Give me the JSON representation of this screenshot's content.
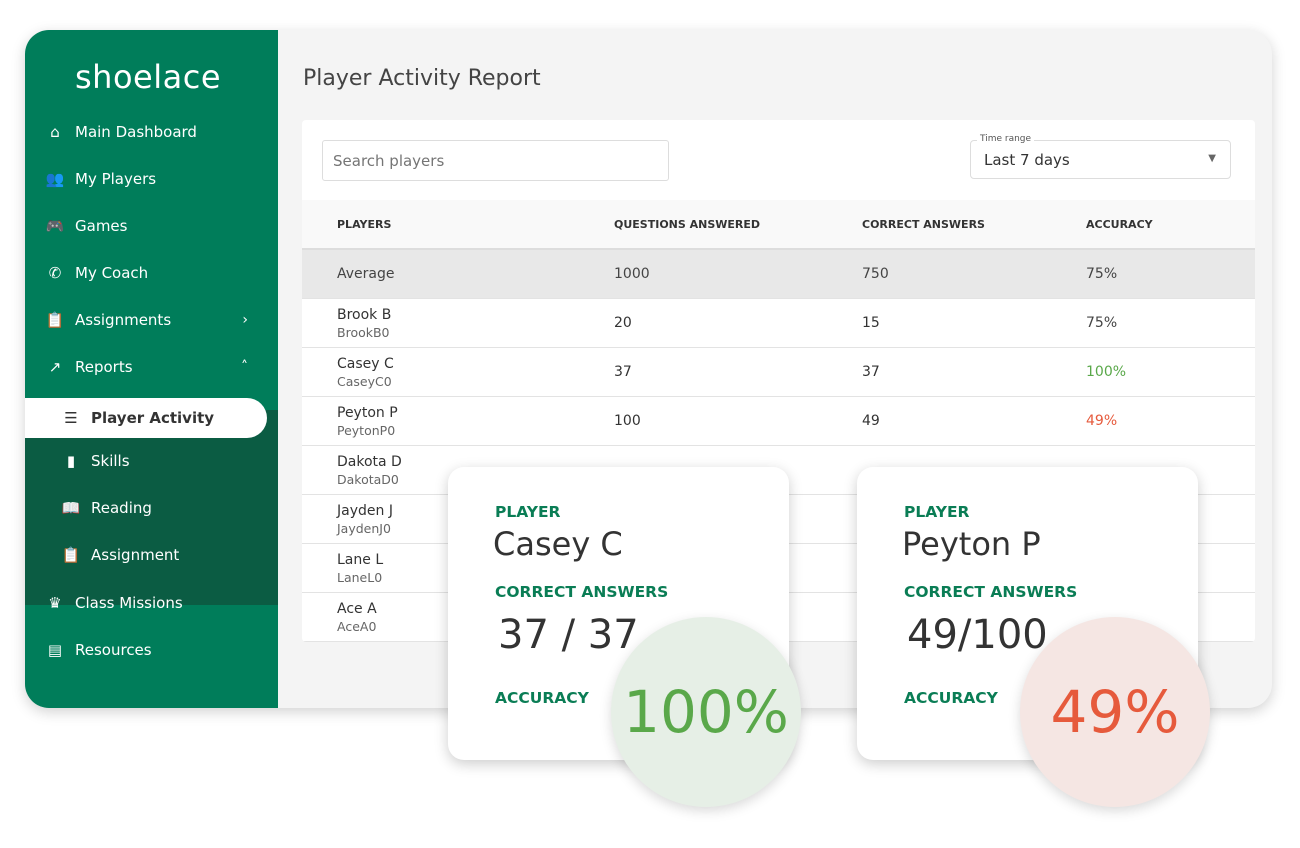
{
  "brand": "shoelace",
  "sidebar": {
    "items": [
      {
        "label": "Main Dashboard",
        "icon": "home-icon"
      },
      {
        "label": "My Players",
        "icon": "players-icon"
      },
      {
        "label": "Games",
        "icon": "gamepad-icon"
      },
      {
        "label": "My Coach",
        "icon": "whistle-icon"
      },
      {
        "label": "Assignments",
        "icon": "clipboard-icon"
      },
      {
        "label": "Reports",
        "icon": "trending-up-icon"
      },
      {
        "label": "Player Activity",
        "icon": "player-list-icon"
      },
      {
        "label": "Skills",
        "icon": "bar-chart-icon"
      },
      {
        "label": "Reading",
        "icon": "book-icon"
      },
      {
        "label": "Assignment",
        "icon": "clipboard-icon"
      },
      {
        "label": "Class Missions",
        "icon": "crown-icon"
      },
      {
        "label": "Resources",
        "icon": "resources-icon"
      }
    ]
  },
  "page": {
    "title": "Player Activity Report"
  },
  "filters": {
    "search_placeholder": "Search players",
    "time_label": "Time range",
    "time_value": "Last 7 days"
  },
  "table": {
    "columns": [
      "PLAYERS",
      "QUESTIONS ANSWERED",
      "CORRECT ANSWERS",
      "ACCURACY"
    ],
    "average": {
      "name": "Average",
      "questions": "1000",
      "correct": "750",
      "accuracy": "75%"
    },
    "rows": [
      {
        "name": "Brook B",
        "user": "BrookB0",
        "questions": "20",
        "correct": "15",
        "accuracy": "75%"
      },
      {
        "name": "Casey C",
        "user": "CaseyC0",
        "questions": "37",
        "correct": "37",
        "accuracy": "100%"
      },
      {
        "name": "Peyton P",
        "user": "PeytonP0",
        "questions": "100",
        "correct": "49",
        "accuracy": "49%"
      },
      {
        "name": "Dakota D",
        "user": "DakotaD0"
      },
      {
        "name": "Jayden J",
        "user": "JaydenJ0"
      },
      {
        "name": "Lane L",
        "user": "LaneL0"
      },
      {
        "name": "Ace A",
        "user": "AceA0"
      }
    ]
  },
  "cards": [
    {
      "player_label": "PLAYER",
      "name": "Casey C",
      "correct_label": "CORRECT ANSWERS",
      "correct": "37 / 37",
      "accuracy_label": "ACCURACY",
      "accuracy": "100%",
      "accuracy_pct": 100
    },
    {
      "player_label": "PLAYER",
      "name": "Peyton P",
      "correct_label": "CORRECT ANSWERS",
      "correct": "49/100",
      "accuracy_label": "ACCURACY",
      "accuracy": "49%",
      "accuracy_pct": 49
    }
  ],
  "colors": {
    "brand": "#007d5a",
    "good": "#5aa84a",
    "bad": "#e65a3c"
  }
}
